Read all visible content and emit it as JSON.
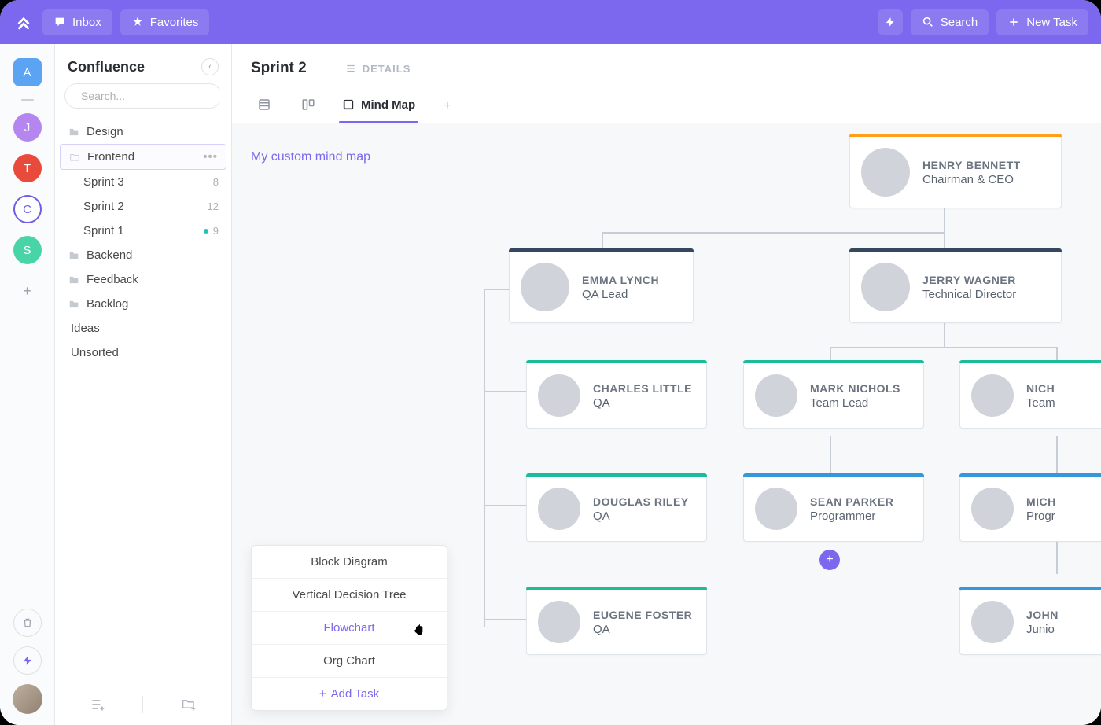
{
  "topbar": {
    "inbox_label": "Inbox",
    "favorites_label": "Favorites",
    "search_label": "Search",
    "new_task_label": "New Task"
  },
  "rail": {
    "workspace_letter": "A",
    "avatars": [
      {
        "letter": "J",
        "cls": "j"
      },
      {
        "letter": "T",
        "cls": "t"
      },
      {
        "letter": "C",
        "cls": "c"
      },
      {
        "letter": "S",
        "cls": "s"
      }
    ]
  },
  "sidebar": {
    "title": "Confluence",
    "search_placeholder": "Search...",
    "items": [
      {
        "label": "Design",
        "type": "folder"
      },
      {
        "label": "Frontend",
        "type": "folder",
        "active": true
      },
      {
        "label": "Sprint 3",
        "type": "sprint",
        "count": "8"
      },
      {
        "label": "Sprint 2",
        "type": "sprint",
        "count": "12"
      },
      {
        "label": "Sprint 1",
        "type": "sprint",
        "count": "9",
        "indicator": true
      },
      {
        "label": "Backend",
        "type": "folder"
      },
      {
        "label": "Feedback",
        "type": "folder"
      },
      {
        "label": "Backlog",
        "type": "folder"
      }
    ],
    "extra": [
      {
        "label": "Ideas"
      },
      {
        "label": "Unsorted"
      }
    ]
  },
  "content": {
    "page_title": "Sprint 2",
    "details_label": "DETAILS",
    "active_tab_label": "Mind Map",
    "mindmap_title": "My custom mind map"
  },
  "org": {
    "ceo": {
      "name": "HENRY BENNETT",
      "role": "Chairman & CEO"
    },
    "qa_lead": {
      "name": "EMMA LYNCH",
      "role": "QA Lead"
    },
    "tech_dir": {
      "name": "JERRY WAGNER",
      "role": "Technical Director"
    },
    "qa1": {
      "name": "CHARLES LITTLE",
      "role": "QA"
    },
    "qa2": {
      "name": "DOUGLAS RILEY",
      "role": "QA"
    },
    "qa3": {
      "name": "EUGENE FOSTER",
      "role": "QA"
    },
    "tl1": {
      "name": "MARK NICHOLS",
      "role": "Team Lead"
    },
    "prog1": {
      "name": "SEAN PARKER",
      "role": "Programmer"
    },
    "tl2_name": "NICH",
    "tl2_role": "Team",
    "prog2_name": "MICH",
    "prog2_role": "Progr",
    "jnr_name": "JOHN",
    "jnr_role": "Junio"
  },
  "popup": {
    "items": [
      {
        "label": "Block Diagram"
      },
      {
        "label": "Vertical Decision Tree"
      },
      {
        "label": "Flowchart",
        "highlighted": true
      },
      {
        "label": "Org Chart"
      }
    ],
    "add_task_label": "Add Task"
  }
}
